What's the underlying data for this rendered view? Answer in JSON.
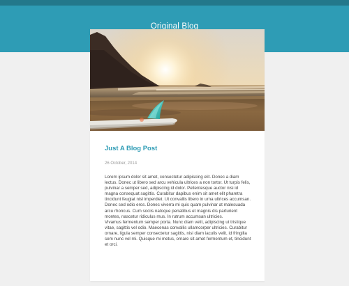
{
  "site": {
    "title": "Original Blog"
  },
  "post": {
    "title": "Just A Blog Post",
    "date": "26 October, 2014",
    "hero_image": "beach-sunset-surfboard-photo",
    "paragraphs": [
      "Lorem ipsum dolor sit amet, consectetur adipiscing elit. Donec a diam lectus. Donec ut libero sed arcu vehicula ultrices a non tortor. Ut turpis felis, pulvinar a semper sed, adipiscing id dolor. Pellentesque auctor nisi id magna consequat sagittis. Curabitur dapibus enim sit amet elit pharetra tincidunt feugiat nisl imperdiet. Ut convallis libero in urna ultrices accumsan. Donec sed odio eros. Donec viverra mi quis quam pulvinar at malesuada arcu rhoncus. Cum sociis natoque penatibus et magnis dis parturient montes, nascetur ridiculus mus. In rutrum accumsan ultricies.",
      "Vivamus fermentum semper porta. Nunc diam velit, adipiscing ut tristique vitae, sagittis vel odio. Maecenas convallis ullamcorper ultricies. Curabitur ornare, ligula semper consectetur sagittis, nisi diam iaculis velit, id fringilla sem nunc vel mi. Quisque mi metus, ornare sit amet fermentum et, tincidunt et orci."
    ]
  },
  "colors": {
    "header": "#2e9cb5",
    "topbar": "#23788b",
    "accent": "#2e9cb5",
    "background": "#f0f0f0"
  }
}
